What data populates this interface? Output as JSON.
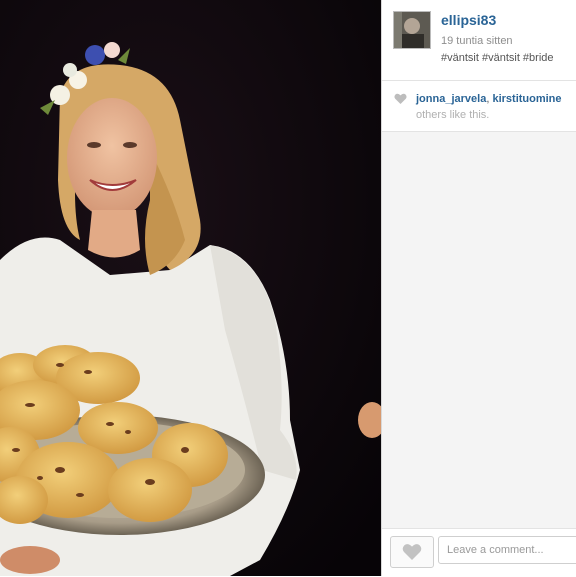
{
  "post": {
    "username": "ellipsi83",
    "time": "19 tuntia sitten",
    "caption": "#väntsit #väntsit #bride"
  },
  "likes": {
    "user1": "jonna_jarvela",
    "separator": ",",
    "user2": "kirstituomine",
    "suffix": "others like this."
  },
  "comment_box": {
    "placeholder": "Leave a comment..."
  },
  "icons": {
    "like_small": "heart-icon",
    "like_button": "heart-icon"
  },
  "colors": {
    "username": "#2a6496",
    "photo_background": "#0e0810"
  }
}
